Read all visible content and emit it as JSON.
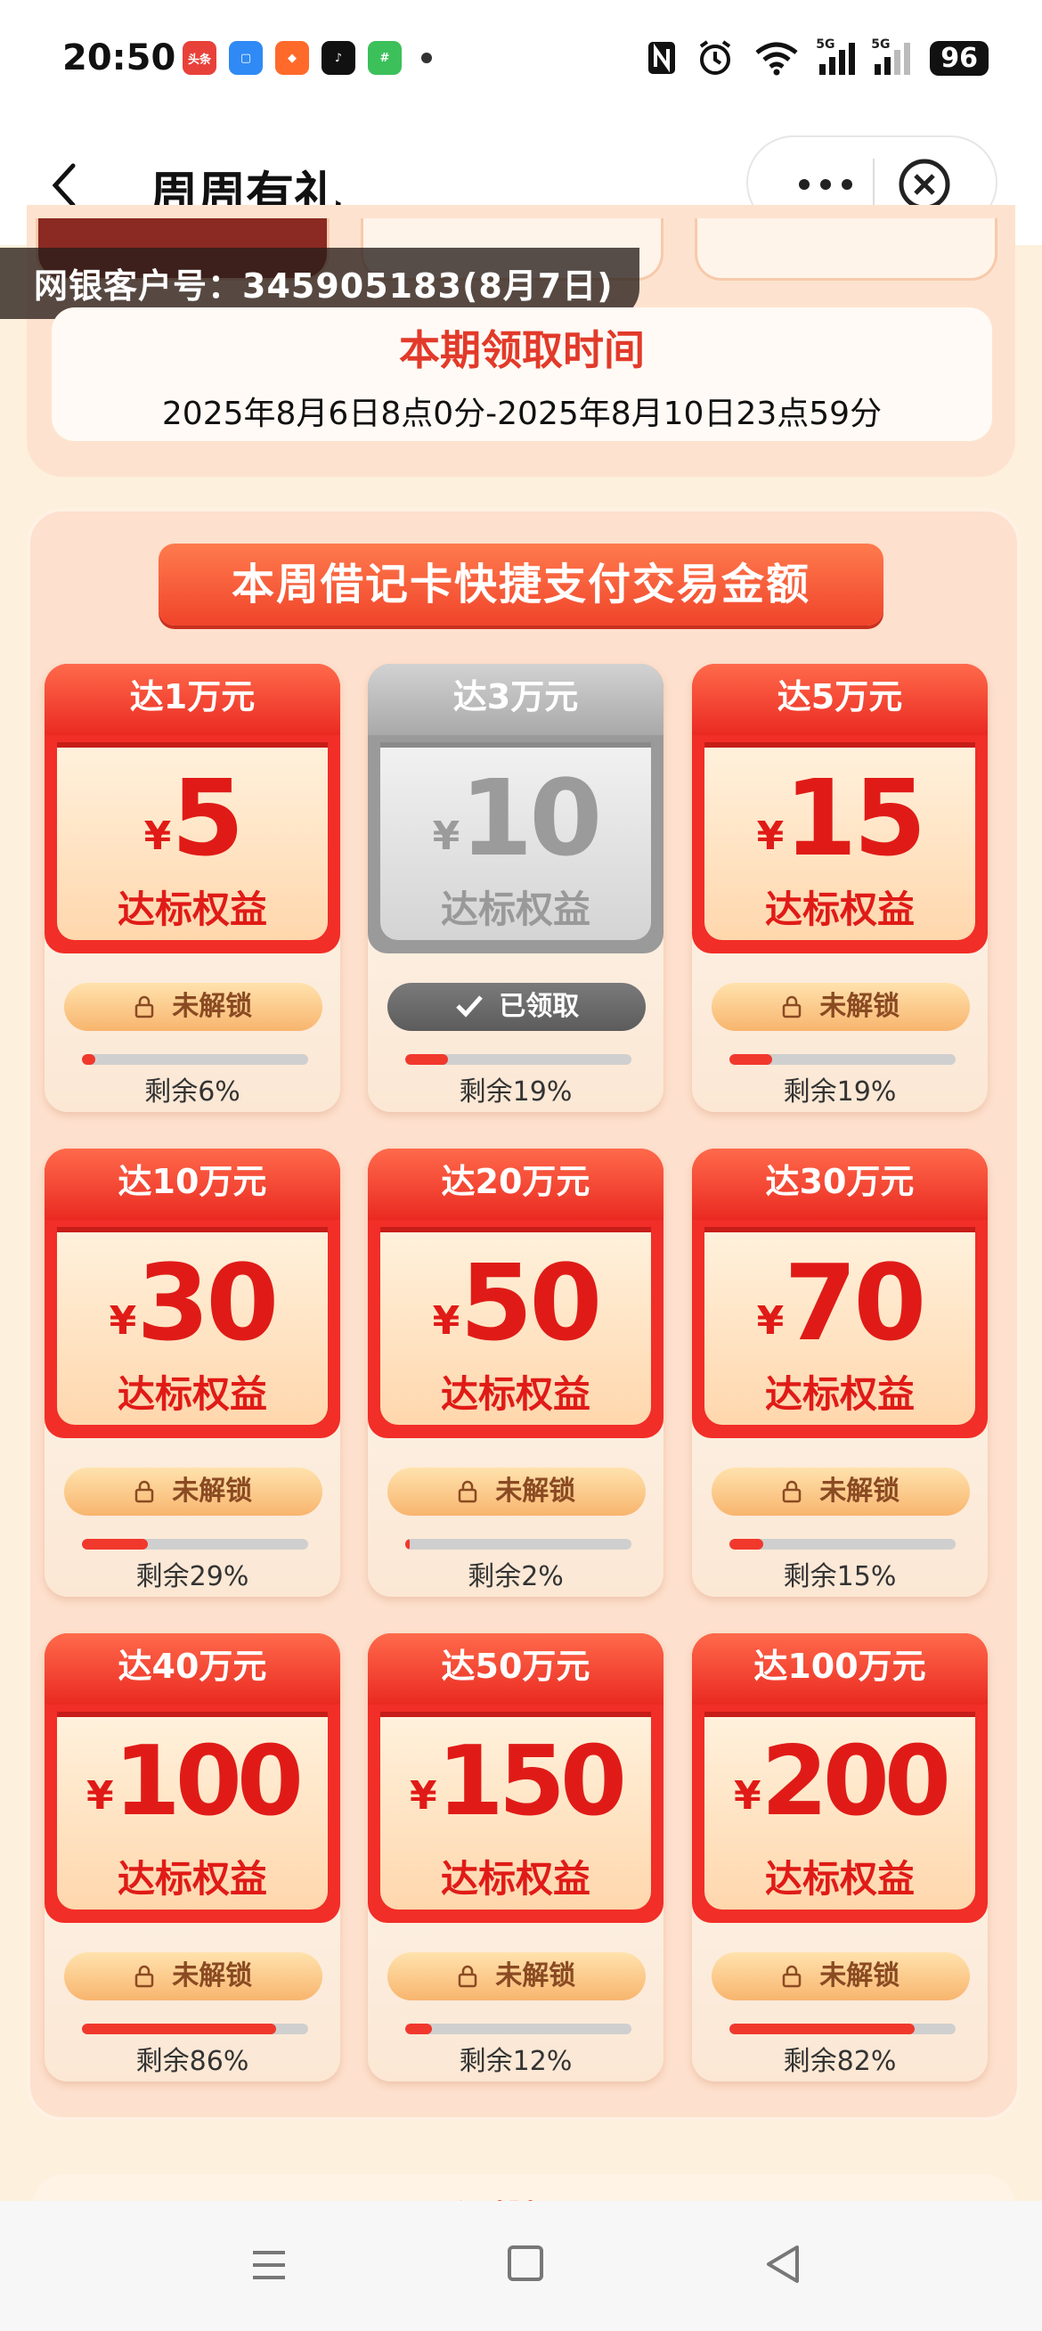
{
  "status_bar": {
    "time": "20:50",
    "battery": "96",
    "app_badge": "头条",
    "net_label": "5G"
  },
  "nav": {
    "title": "周周有礼"
  },
  "account": {
    "text": "网银客户号：345905183(8月7日)"
  },
  "period": {
    "title": "本期领取时间",
    "range": "2025年8月6日8点0分-2025年8月10日23点59分"
  },
  "panel": {
    "heading": "本周借记卡快捷支付交易金额"
  },
  "cards": [
    {
      "threshold": "达1万元",
      "currency": "¥",
      "amount": "5",
      "benefit": "达标权益",
      "button": "未解锁",
      "remaining_label": "剩余6%",
      "remaining": 0.06,
      "state": "locked"
    },
    {
      "threshold": "达3万元",
      "currency": "¥",
      "amount": "10",
      "benefit": "达标权益",
      "button": "已领取",
      "remaining_label": "剩余19%",
      "remaining": 0.19,
      "state": "claimed"
    },
    {
      "threshold": "达5万元",
      "currency": "¥",
      "amount": "15",
      "benefit": "达标权益",
      "button": "未解锁",
      "remaining_label": "剩余19%",
      "remaining": 0.19,
      "state": "locked"
    },
    {
      "threshold": "达10万元",
      "currency": "¥",
      "amount": "30",
      "benefit": "达标权益",
      "button": "未解锁",
      "remaining_label": "剩余29%",
      "remaining": 0.29,
      "state": "locked"
    },
    {
      "threshold": "达20万元",
      "currency": "¥",
      "amount": "50",
      "benefit": "达标权益",
      "button": "未解锁",
      "remaining_label": "剩余2%",
      "remaining": 0.02,
      "state": "locked"
    },
    {
      "threshold": "达30万元",
      "currency": "¥",
      "amount": "70",
      "benefit": "达标权益",
      "button": "未解锁",
      "remaining_label": "剩余15%",
      "remaining": 0.15,
      "state": "locked"
    },
    {
      "threshold": "达40万元",
      "currency": "¥",
      "amount": "100",
      "benefit": "达标权益",
      "button": "未解锁",
      "remaining_label": "剩余86%",
      "remaining": 0.86,
      "state": "locked"
    },
    {
      "threshold": "达50万元",
      "currency": "¥",
      "amount": "150",
      "benefit": "达标权益",
      "button": "未解锁",
      "remaining_label": "剩余12%",
      "remaining": 0.12,
      "state": "locked"
    },
    {
      "threshold": "达100万元",
      "currency": "¥",
      "amount": "200",
      "benefit": "达标权益",
      "button": "未解锁",
      "remaining_label": "剩余82%",
      "remaining": 0.82,
      "state": "locked"
    }
  ],
  "colors": {
    "accent_red": "#f12e27",
    "progress_fill": "#f1382c",
    "panel_bg": "#fde0cd"
  }
}
